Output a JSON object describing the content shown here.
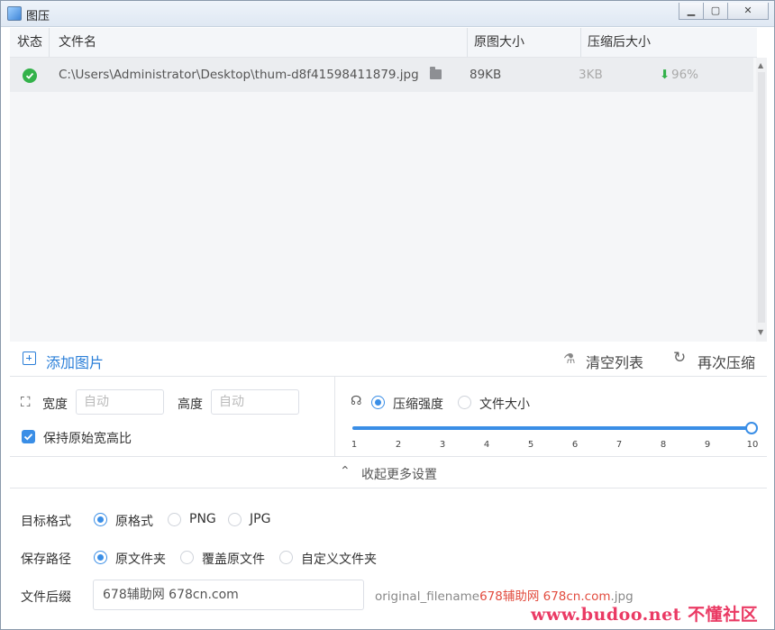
{
  "window": {
    "title": "图压",
    "min_label": "▁",
    "max_label": "▢",
    "close_label": "✕"
  },
  "table": {
    "headers": [
      "状态",
      "文件名",
      "原图大小",
      "压缩后大小"
    ],
    "rows": [
      {
        "status": "success",
        "filename": "C:\\Users\\Administrator\\Desktop\\thum-d8f41598411879.jpg",
        "original_size": "89KB",
        "compressed_size": "3KB",
        "ratio": "96%"
      }
    ]
  },
  "actions": {
    "add": "添加图片",
    "clear": "清空列表",
    "recompress": "再次压缩"
  },
  "resize": {
    "width_label": "宽度",
    "height_label": "高度",
    "width_placeholder": "自动",
    "height_placeholder": "自动",
    "keep_ratio_label": "保持原始宽高比",
    "keep_ratio": true
  },
  "compress": {
    "mode_strength": "压缩强度",
    "mode_size": "文件大小",
    "selected_mode": "压缩强度",
    "ticks": [
      "1",
      "2",
      "3",
      "4",
      "5",
      "6",
      "7",
      "8",
      "9",
      "10"
    ],
    "level": 10,
    "level_max": 10
  },
  "collapse_label": "收起更多设置",
  "format": {
    "label": "目标格式",
    "options": [
      "原格式",
      "PNG",
      "JPG"
    ],
    "selected": "原格式"
  },
  "save_path": {
    "label": "保存路径",
    "options": [
      "原文件夹",
      "覆盖原文件",
      "自定义文件夹"
    ],
    "selected": "原文件夹"
  },
  "suffix": {
    "label": "文件后缀",
    "value": "678辅助网 678cn.com",
    "preview_prefix": "original_filename",
    "preview_suffix": "678辅助网 678cn.com",
    "preview_ext": ".jpg"
  },
  "watermark": "www.budoo.net 不懂社区",
  "colors": {
    "accent": "#3a8ee6",
    "success": "#33b24a",
    "ratio": "#33b24a",
    "highlight": "#e24c3f"
  }
}
